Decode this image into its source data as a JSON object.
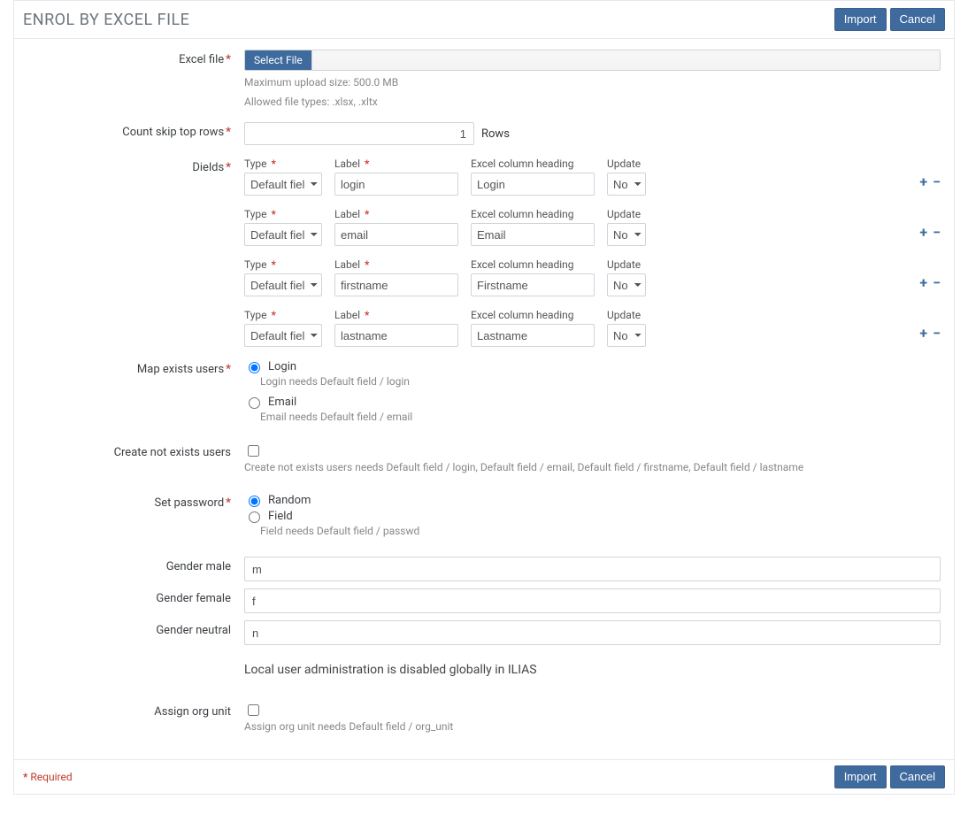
{
  "header": {
    "title": "ENROL BY EXCEL FILE"
  },
  "buttons": {
    "import": "Import",
    "cancel": "Cancel",
    "select_file": "Select File"
  },
  "labels": {
    "excel_file": "Excel file",
    "count_skip": "Count skip top rows",
    "fields": "Dields",
    "map_exists": "Map exists users",
    "create_not_exists": "Create not exists users",
    "set_password": "Set password",
    "gender_male": "Gender male",
    "gender_female": "Gender female",
    "gender_neutral": "Gender neutral",
    "assign_org": "Assign org unit",
    "rows_suffix": "Rows"
  },
  "field_headers": {
    "type": "Type",
    "label": "Label",
    "heading": "Excel column heading",
    "update": "Update"
  },
  "hints": {
    "upload_size": "Maximum upload size: 500.0 MB",
    "file_types": "Allowed file types: .xlsx, .xltx",
    "login_needs": "Login needs Default field / login",
    "email_needs": "Email needs Default field / email",
    "create_needs": "Create not exists users needs Default field / login, Default field / email, Default field / firstname, Default field / lastname",
    "field_needs": "Field needs Default field / passwd",
    "local_admin_disabled": "Local user administration is disabled globally in ILIAS",
    "assign_org_needs": "Assign org unit needs Default field / org_unit"
  },
  "count_skip_value": "1",
  "field_defaults": {
    "type_option": "Default field",
    "update_option": "No"
  },
  "fields": [
    {
      "label_value": "login",
      "heading_value": "Login"
    },
    {
      "label_value": "email",
      "heading_value": "Email"
    },
    {
      "label_value": "firstname",
      "heading_value": "Firstname"
    },
    {
      "label_value": "lastname",
      "heading_value": "Lastname"
    }
  ],
  "map_exists": {
    "login": {
      "text": "Login",
      "checked": true
    },
    "email": {
      "text": "Email",
      "checked": false
    }
  },
  "set_password": {
    "random": {
      "text": "Random",
      "checked": true
    },
    "field": {
      "text": "Field",
      "checked": false
    }
  },
  "gender": {
    "male": "m",
    "female": "f",
    "neutral": "n"
  },
  "footer": {
    "required": "Required"
  }
}
